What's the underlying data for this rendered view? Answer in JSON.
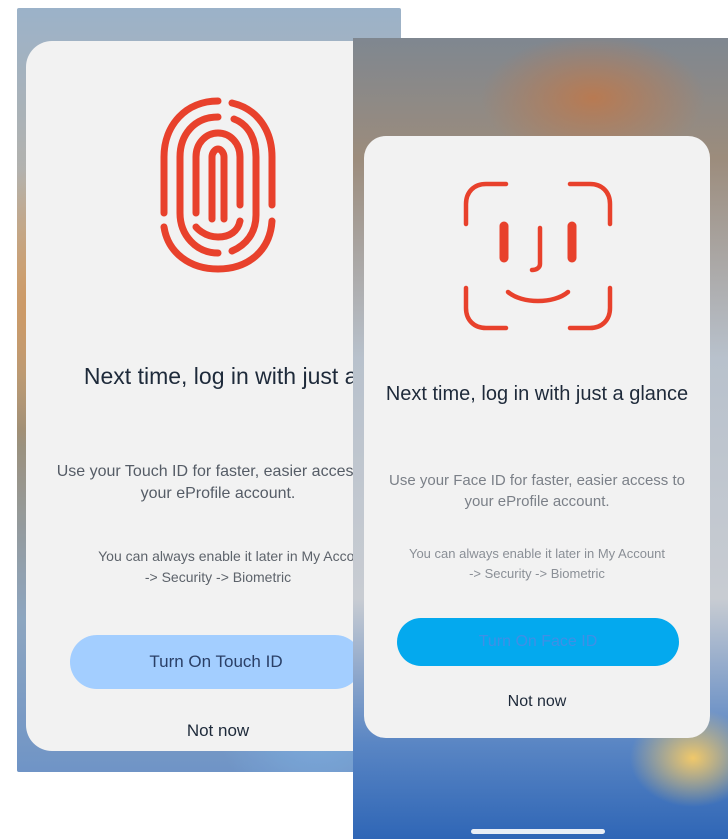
{
  "touch_screen": {
    "title": "Next time, log in with just a touch",
    "description": "Use your Touch ID for faster, easier access to your eProfile account.",
    "note_line1": "You can always enable it later in My Account",
    "note_line2": "-> Security -> Biometric",
    "primary_button": "Turn On Touch ID",
    "secondary_button": "Not now",
    "icon": "fingerprint-icon",
    "accent_color": "#e8412c",
    "button_color": "#a3ceff"
  },
  "face_screen": {
    "title": "Next time, log in with just a glance",
    "description": "Use your Face ID for faster, easier access to your eProfile account.",
    "note_line1": "You can always enable it later in My Account",
    "note_line2": "-> Security -> Biometric",
    "primary_button": "Turn On Face ID",
    "secondary_button": "Not now",
    "icon": "face-id-icon",
    "accent_color": "#e8412c",
    "button_color": "#04a9ee"
  }
}
